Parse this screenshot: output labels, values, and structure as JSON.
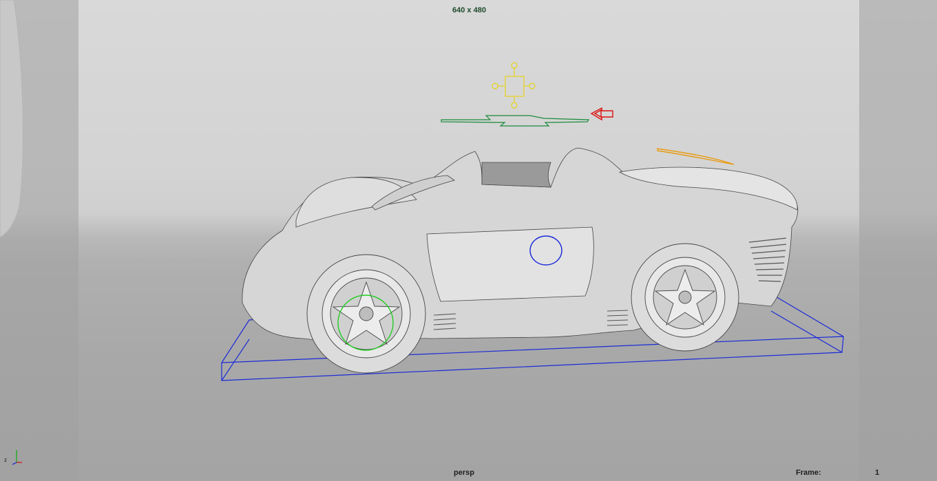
{
  "viewport": {
    "resolution_gate": "640 x 480",
    "camera_name": "persp",
    "frame_label": "Frame:",
    "frame_value": "1"
  },
  "axis": {
    "z_label": "z",
    "x_color": "#cc2222",
    "y_color": "#22aa22"
  },
  "colors": {
    "bounding_box": "#1a2ad8",
    "wheel_control": "#22cc22",
    "fuel_cap_circle": "#1a2ad8",
    "gizmo_yellow": "#e6d21a",
    "arrow_red": "#dd1010",
    "green_curve": "#1a8a3a",
    "orange_curve": "#e89a10"
  }
}
